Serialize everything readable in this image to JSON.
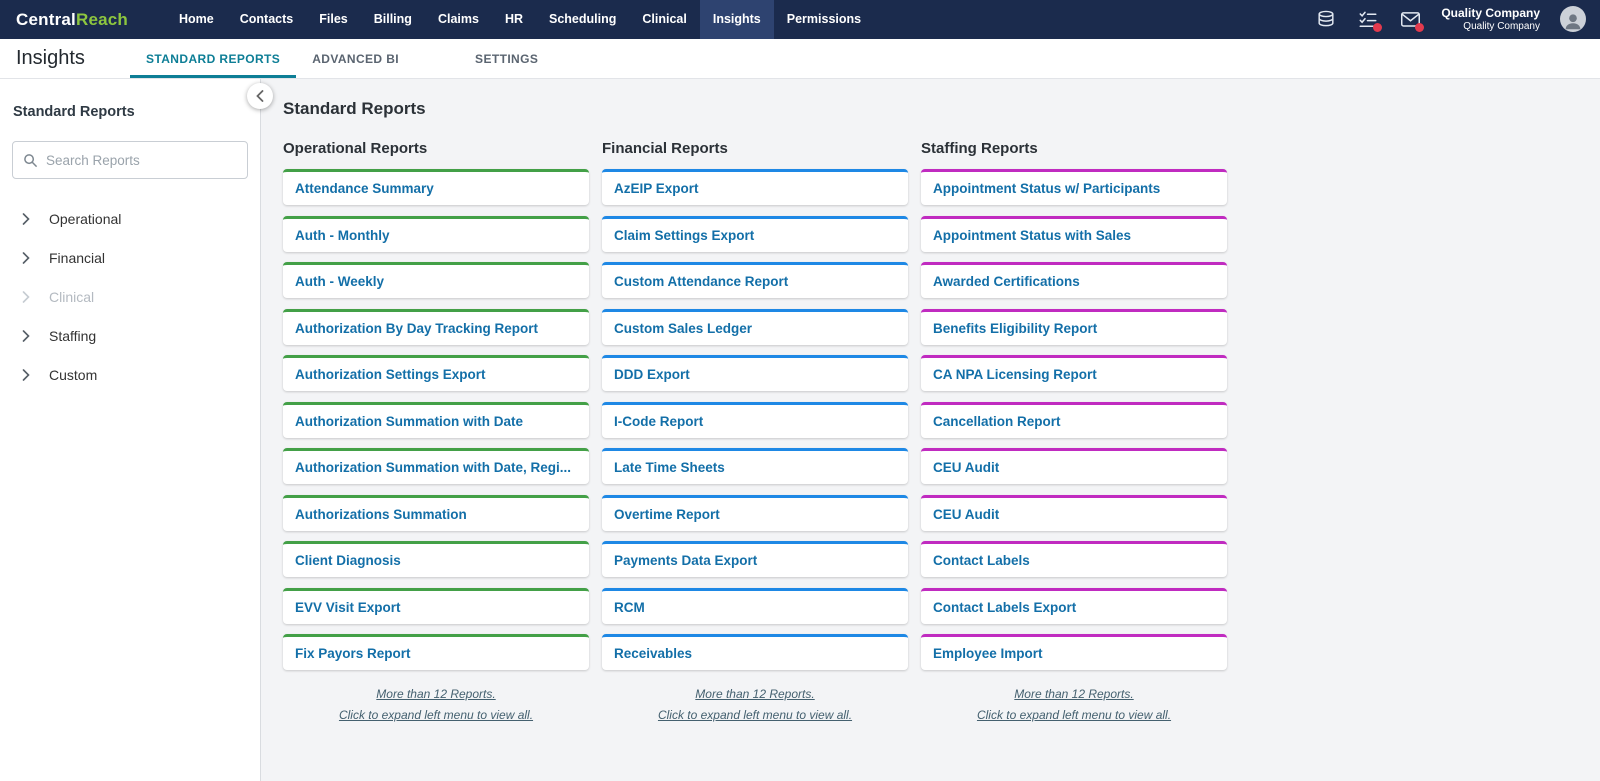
{
  "navbar": {
    "logo": {
      "part1": "Central",
      "part2": "Reach"
    },
    "items": [
      {
        "label": "Home",
        "active": false
      },
      {
        "label": "Contacts",
        "active": false
      },
      {
        "label": "Files",
        "active": false
      },
      {
        "label": "Billing",
        "active": false
      },
      {
        "label": "Claims",
        "active": false
      },
      {
        "label": "HR",
        "active": false
      },
      {
        "label": "Scheduling",
        "active": false
      },
      {
        "label": "Clinical",
        "active": false
      },
      {
        "label": "Insights",
        "active": true
      },
      {
        "label": "Permissions",
        "active": false
      }
    ],
    "icons": [
      {
        "name": "apps-stack-icon",
        "badge": false
      },
      {
        "name": "tasks-icon",
        "badge": true
      },
      {
        "name": "mail-icon",
        "badge": true
      }
    ],
    "company": {
      "name": "Quality Company",
      "subname": "Quality Company"
    }
  },
  "subheader": {
    "title": "Insights",
    "tabs": [
      {
        "label": "STANDARD REPORTS",
        "active": true
      },
      {
        "label": "ADVANCED BI",
        "active": false
      },
      {
        "label": "SETTINGS",
        "active": false
      }
    ]
  },
  "sidebar": {
    "title": "Standard Reports",
    "search_placeholder": "Search Reports",
    "items": [
      {
        "label": "Operational",
        "disabled": false
      },
      {
        "label": "Financial",
        "disabled": false
      },
      {
        "label": "Clinical",
        "disabled": true
      },
      {
        "label": "Staffing",
        "disabled": false
      },
      {
        "label": "Custom",
        "disabled": false
      }
    ]
  },
  "main": {
    "title": "Standard Reports",
    "columns": [
      {
        "header": "Operational Reports",
        "accent": "#43a047",
        "reports": [
          "Attendance Summary",
          "Auth - Monthly",
          "Auth - Weekly",
          "Authorization By Day Tracking Report",
          "Authorization Settings Export",
          "Authorization Summation with Date",
          "Authorization Summation with Date, Regi...",
          "Authorizations Summation",
          "Client Diagnosis",
          "EVV Visit Export",
          "Fix Payors Report"
        ],
        "more_line1": "More than 12 Reports.",
        "more_line2": "Click to expand left menu to view all."
      },
      {
        "header": "Financial Reports",
        "accent": "#1e88e5",
        "reports": [
          "AzEIP Export",
          "Claim Settings Export",
          "Custom Attendance Report",
          "Custom Sales Ledger",
          "DDD Export",
          "I-Code Report",
          "Late Time Sheets",
          "Overtime Report",
          "Payments Data Export",
          "RCM",
          "Receivables"
        ],
        "more_line1": "More than 12 Reports.",
        "more_line2": "Click to expand left menu to view all."
      },
      {
        "header": "Staffing Reports",
        "accent": "#c02bc0",
        "reports": [
          "Appointment Status w/ Participants",
          "Appointment Status with Sales",
          "Awarded Certifications",
          "Benefits Eligibility Report",
          "CA NPA Licensing Report",
          "Cancellation Report",
          "CEU Audit",
          "CEU Audit",
          "Contact Labels",
          "Contact Labels Export",
          "Employee Import"
        ],
        "more_line1": "More than 12 Reports.",
        "more_line2": "Click to expand left menu to view all."
      }
    ]
  },
  "colors": {
    "navbar_bg": "#1b2b4d",
    "nav_active_bg": "#2e4370",
    "logo_green": "#8dc63f",
    "tab_active": "#0d7e96",
    "link_blue": "#136fa8",
    "accent_green": "#43a047",
    "accent_blue": "#1e88e5",
    "accent_magenta": "#c02bc0",
    "badge_red": "#e33a4e"
  }
}
